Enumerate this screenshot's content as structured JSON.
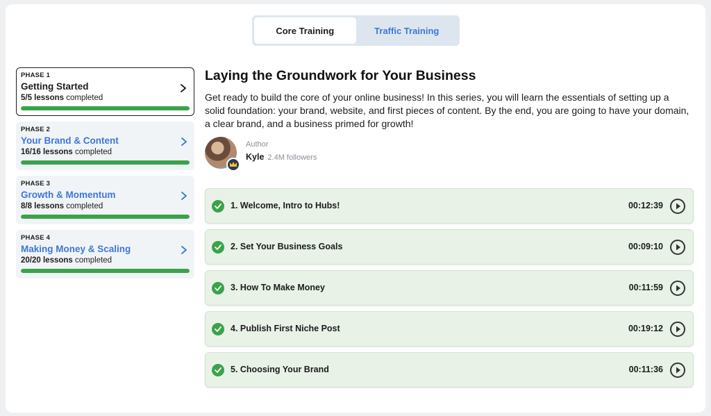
{
  "tabs": [
    {
      "label": "Core Training",
      "active": true
    },
    {
      "label": "Traffic Training",
      "active": false
    }
  ],
  "phases": [
    {
      "label": "PHASE 1",
      "title": "Getting Started",
      "completed": "5/5 lessons",
      "suffix": "completed",
      "progress": 1.0,
      "active": true
    },
    {
      "label": "PHASE 2",
      "title": "Your Brand & Content",
      "completed": "16/16 lessons",
      "suffix": "completed",
      "progress": 1.0,
      "active": false
    },
    {
      "label": "PHASE 3",
      "title": "Growth & Momentum",
      "completed": "8/8 lessons",
      "suffix": "completed",
      "progress": 1.0,
      "active": false
    },
    {
      "label": "PHASE 4",
      "title": "Making Money & Scaling",
      "completed": "20/20 lessons",
      "suffix": "completed",
      "progress": 1.0,
      "active": false
    }
  ],
  "main": {
    "title": "Laying the Groundwork for Your Business",
    "description": "Get ready to build the core of your online business! In this series, you will learn the essentials of setting up a solid foundation: your brand, website, and first pieces of content. By the end, you are going to have your domain, a clear brand, and a business primed for growth!",
    "author": {
      "label": "Author",
      "name": "Kyle",
      "followers": "2.4M followers"
    },
    "lessons": [
      {
        "title": "1. Welcome, Intro to Hubs!",
        "duration": "00:12:39"
      },
      {
        "title": "2. Set Your Business Goals",
        "duration": "00:09:10"
      },
      {
        "title": "3. How To Make Money",
        "duration": "00:11:59"
      },
      {
        "title": "4. Publish First Niche Post",
        "duration": "00:19:12"
      },
      {
        "title": "5. Choosing Your Brand",
        "duration": "00:11:36"
      }
    ]
  },
  "colors": {
    "accent": "#3b78d6",
    "success": "#3aa34a",
    "lesson_bg": "#e8f2e7",
    "tab_bg": "#dde6ee"
  },
  "icons": {
    "phase_arrow": "chevron-right-icon",
    "lesson_status": "check-circle-icon",
    "lesson_action": "play-circle-icon",
    "author_badge": "crown-icon"
  }
}
